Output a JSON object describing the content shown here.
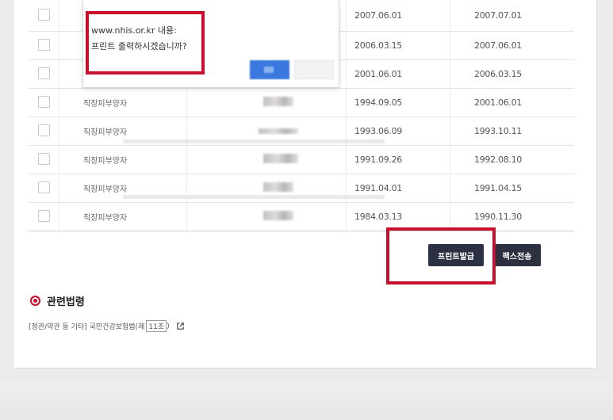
{
  "dialog": {
    "origin": "www.nhis.or.kr 내용:",
    "message": "프린트 출력하시겠습니까?"
  },
  "table": {
    "rows": [
      {
        "type": "",
        "start": "2007.06.01",
        "end": "2007.07.01"
      },
      {
        "type": "",
        "start": "2006.03.15",
        "end": "2007.06.01"
      },
      {
        "type": "",
        "start": "2001.06.01",
        "end": "2006.03.15"
      },
      {
        "type": "직장피부양자",
        "start": "1994.09.05",
        "end": "2001.06.01"
      },
      {
        "type": "직장피부양자",
        "start": "1993.06.09",
        "end": "1993.10.11"
      },
      {
        "type": "직장피부양자",
        "start": "1991.09.26",
        "end": "1992.08.10"
      },
      {
        "type": "직장피부양자",
        "start": "1991.04.01",
        "end": "1991.04.15"
      },
      {
        "type": "직장피부양자",
        "start": "1984.03.13",
        "end": "1990.11.30"
      }
    ]
  },
  "buttons": {
    "print_label": "프린트발급",
    "fax_label": "팩스전송"
  },
  "related_laws": {
    "title": "관련법령",
    "link_prefix": "[정관/약관 등 기타] 국민건강보험법(제",
    "link_num": "11조",
    "link_suffix": ")"
  },
  "colors": {
    "highlight": "#c8102e",
    "button_bg": "#2c3142",
    "dialog_ok": "#3a78e0"
  }
}
